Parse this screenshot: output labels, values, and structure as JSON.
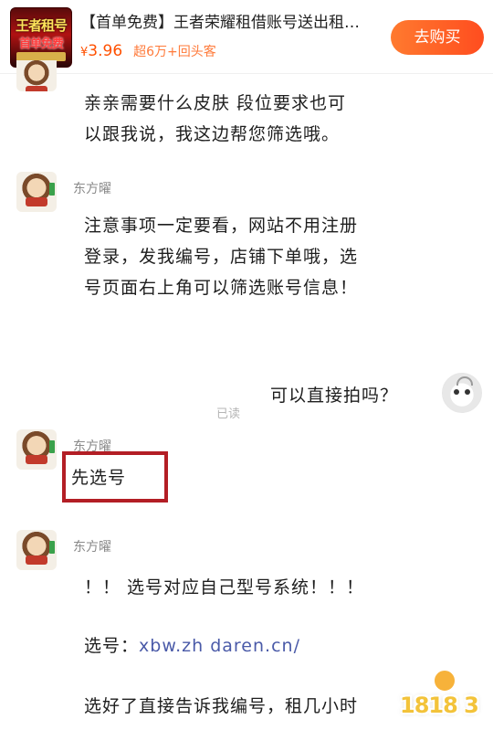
{
  "product": {
    "thumb_line1": "王者租号",
    "thumb_line2": "首单免费",
    "title": "【首单免费】王者荣耀租借账号送出租…",
    "price_symbol": "¥",
    "price": "3.96",
    "sales": "超6万+回头客",
    "buy_label": "去购买"
  },
  "messages": [
    {
      "lines": [
        "亲亲需要什么皮肤 段位要求也可",
        "以跟我说，我这边帮您筛选哦。"
      ]
    },
    {
      "sender": "东方曜",
      "lines": [
        "注意事项一定要看，网站不用注册",
        "登录，发我编号，店铺下单哦，选",
        "号页面右上角可以筛选账号信息！"
      ]
    },
    {
      "user_text": "可以直接拍吗？",
      "read": "已读"
    },
    {
      "sender": "东方曜",
      "text": "先选号"
    },
    {
      "sender": "东方曜",
      "line1": "！！ 选号对应自己型号系统！！！",
      "line2_label": "选号：",
      "line2_link": "xbw.zh      daren.cn/",
      "line3": "选好了直接告诉我编号，租几小时"
    }
  ],
  "watermark": {
    "text": "1818 3"
  },
  "colors": {
    "accent": "#ff5000",
    "highlight_border": "#b31e25",
    "link": "#4a5aa8"
  }
}
